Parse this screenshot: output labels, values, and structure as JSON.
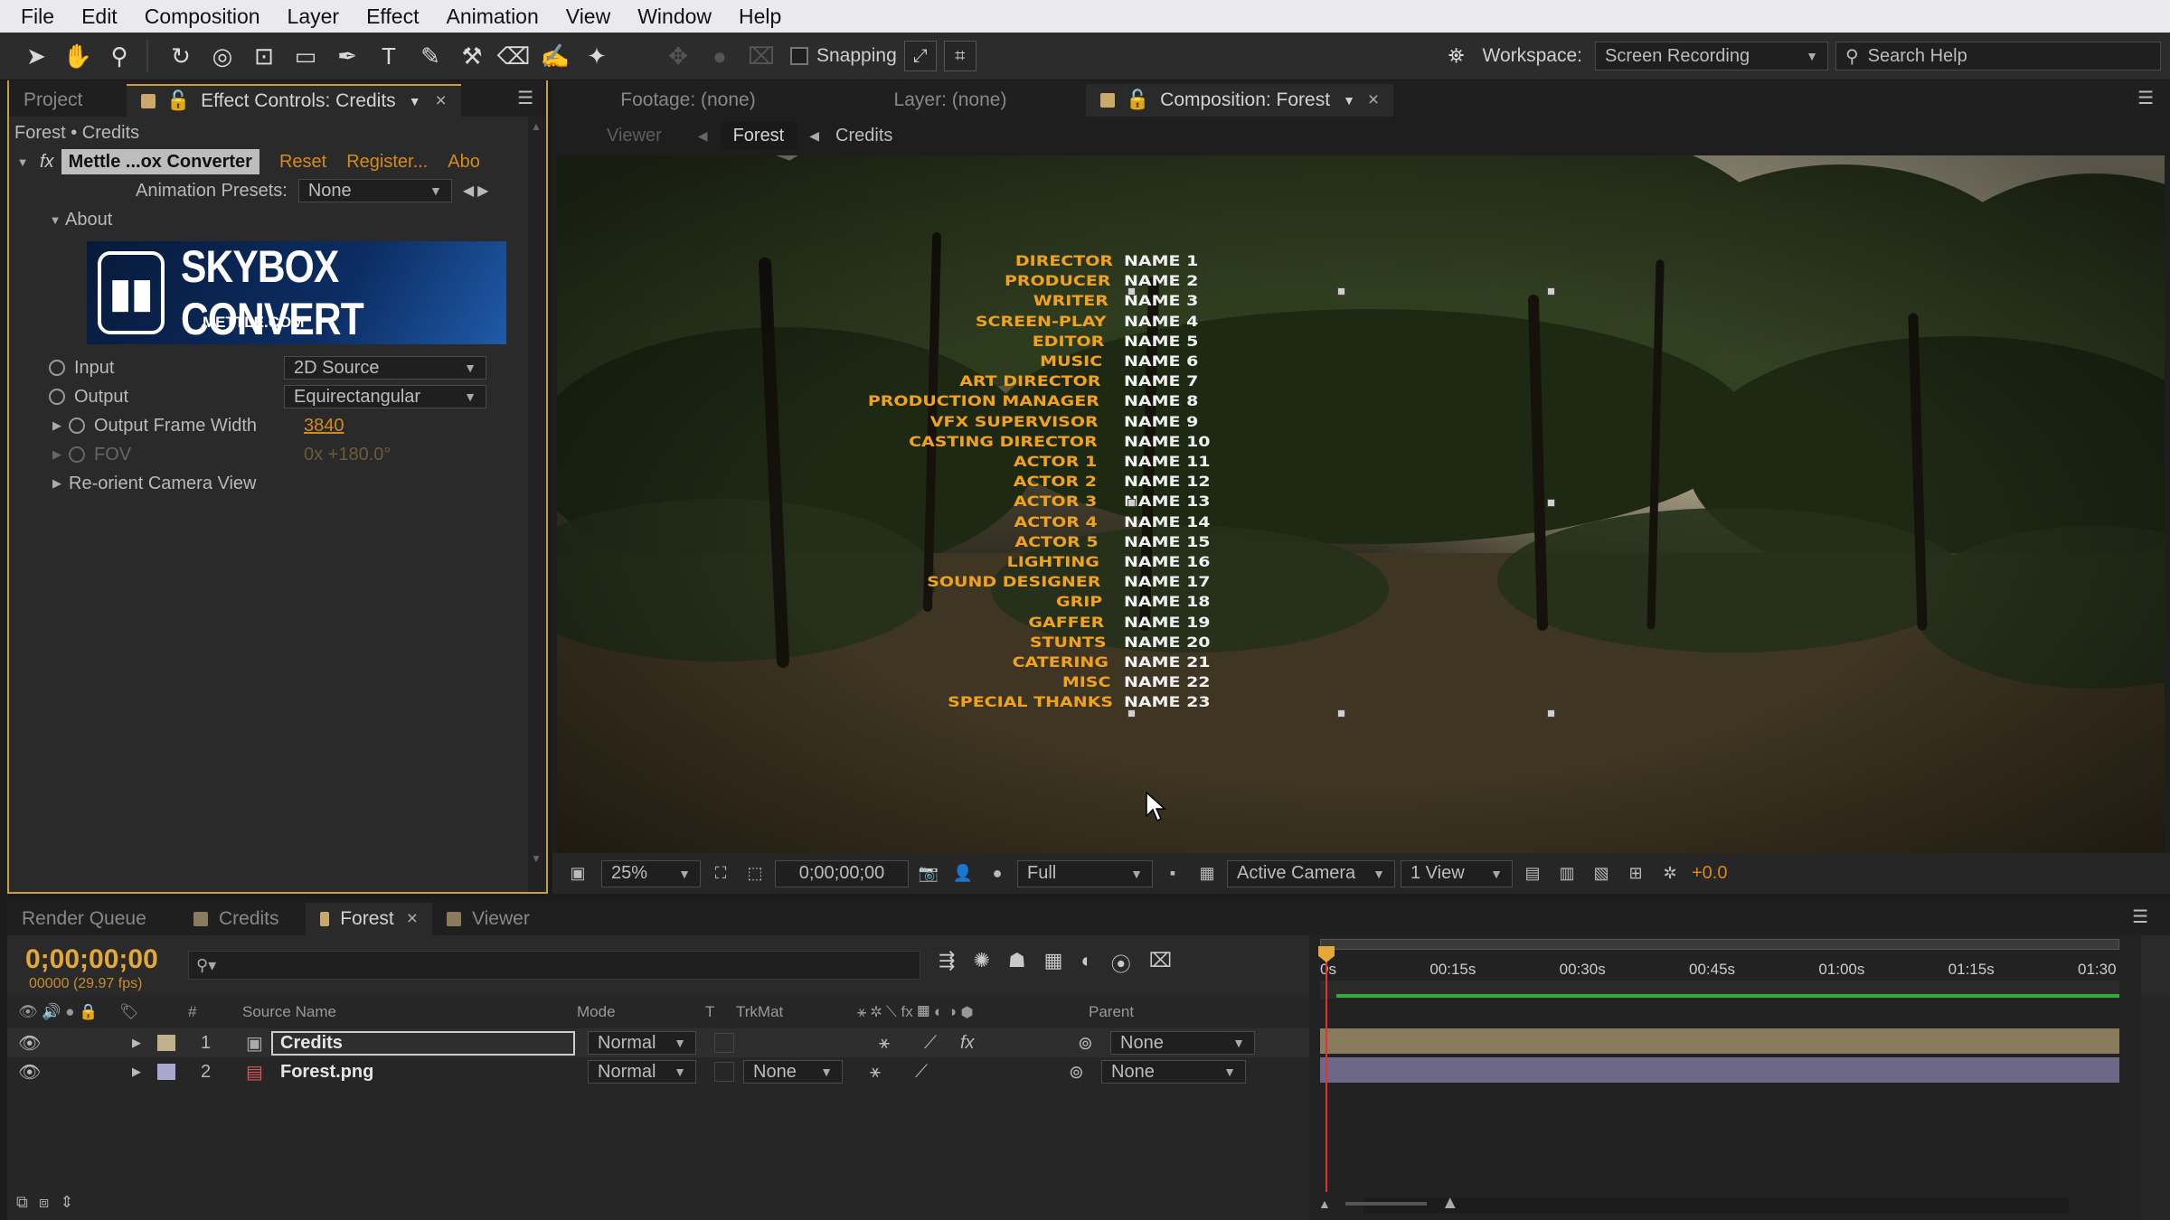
{
  "menu": [
    "File",
    "Edit",
    "Composition",
    "Layer",
    "Effect",
    "Animation",
    "View",
    "Window",
    "Help"
  ],
  "toolbar": {
    "snapping_label": "Snapping",
    "workspace_label": "Workspace:",
    "workspace_value": "Screen Recording",
    "search_placeholder": "Search Help"
  },
  "left_tabs": {
    "project": "Project",
    "effect_controls": "Effect Controls: Credits"
  },
  "breadcrumb": "Forest • Credits",
  "effect": {
    "name": "Mettle ...ox Converter",
    "reset": "Reset",
    "register": "Register...",
    "about_link": "Abo",
    "presets_label": "Animation Presets:",
    "presets_value": "None",
    "about_group": "About",
    "logo_text": "SKYBOX CONVERT",
    "logo_sub": "METTLE.COM",
    "props": [
      {
        "label": "Input",
        "value": "2D Source"
      },
      {
        "label": "Output",
        "value": "Equirectangular"
      },
      {
        "label": "Output Frame Width",
        "value": "3840"
      },
      {
        "label": "FOV",
        "value": "0x +180.0°"
      }
    ],
    "reorient": "Re-orient Camera View"
  },
  "viewer": {
    "tabs": {
      "footage": "Footage: (none)",
      "layer": "Layer: (none)",
      "composition": "Composition: Forest"
    },
    "subtabs": {
      "viewer": "Viewer",
      "forest": "Forest",
      "credits": "Credits"
    },
    "footer": {
      "zoom": "25%",
      "timecode": "0;00;00;00",
      "resolution": "Full",
      "camera": "Active Camera",
      "views": "1 View",
      "exposure": "+0.0"
    }
  },
  "credits": [
    {
      "role": "DIRECTOR",
      "name": "NAME 1"
    },
    {
      "role": "PRODUCER",
      "name": "NAME 2"
    },
    {
      "role": "WRITER",
      "name": "NAME 3"
    },
    {
      "role": "SCREEN-PLAY",
      "name": "NAME 4"
    },
    {
      "role": "EDITOR",
      "name": "NAME 5"
    },
    {
      "role": "MUSIC",
      "name": "NAME 6"
    },
    {
      "role": "ART DIRECTOR",
      "name": "NAME 7"
    },
    {
      "role": "PRODUCTION MANAGER",
      "name": "NAME 8"
    },
    {
      "role": "VFX SUPERVISOR",
      "name": "NAME 9"
    },
    {
      "role": "CASTING DIRECTOR",
      "name": "NAME 10"
    },
    {
      "role": "ACTOR 1",
      "name": "NAME 11"
    },
    {
      "role": "ACTOR 2",
      "name": "NAME 12"
    },
    {
      "role": "ACTOR 3",
      "name": "NAME 13"
    },
    {
      "role": "ACTOR 4",
      "name": "NAME 14"
    },
    {
      "role": "ACTOR 5",
      "name": "NAME 15"
    },
    {
      "role": "LIGHTING",
      "name": "NAME 16"
    },
    {
      "role": "SOUND DESIGNER",
      "name": "NAME 17"
    },
    {
      "role": "GRIP",
      "name": "NAME 18"
    },
    {
      "role": "GAFFER",
      "name": "NAME 19"
    },
    {
      "role": "STUNTS",
      "name": "NAME 20"
    },
    {
      "role": "CATERING",
      "name": "NAME 21"
    },
    {
      "role": "MISC",
      "name": "NAME 22"
    },
    {
      "role": "SPECIAL THANKS",
      "name": "NAME 23"
    }
  ],
  "timeline": {
    "tabs": {
      "render": "Render Queue",
      "credits": "Credits",
      "forest": "Forest",
      "viewer": "Viewer"
    },
    "timecode": "0;00;00;00",
    "timecode_sub": "00000 (29.97 fps)",
    "columns": {
      "num": "#",
      "source": "Source Name",
      "mode": "Mode",
      "t": "T",
      "trkmat": "TrkMat",
      "parent": "Parent"
    },
    "layers": [
      {
        "num": "1",
        "name": "Credits",
        "mode": "Normal",
        "trkmat": "",
        "parent": "None"
      },
      {
        "num": "2",
        "name": "Forest.png",
        "mode": "Normal",
        "trkmat": "None",
        "parent": "None"
      }
    ],
    "ruler": [
      "0s",
      "00:15s",
      "00:30s",
      "00:45s",
      "01:00s",
      "01:15s",
      "01:30"
    ]
  },
  "colors": {
    "accent": "#e3a838",
    "credits_role": "#f0a21d",
    "layer1_bar": "#8a7a5e",
    "layer2_bar": "#6d6888"
  }
}
